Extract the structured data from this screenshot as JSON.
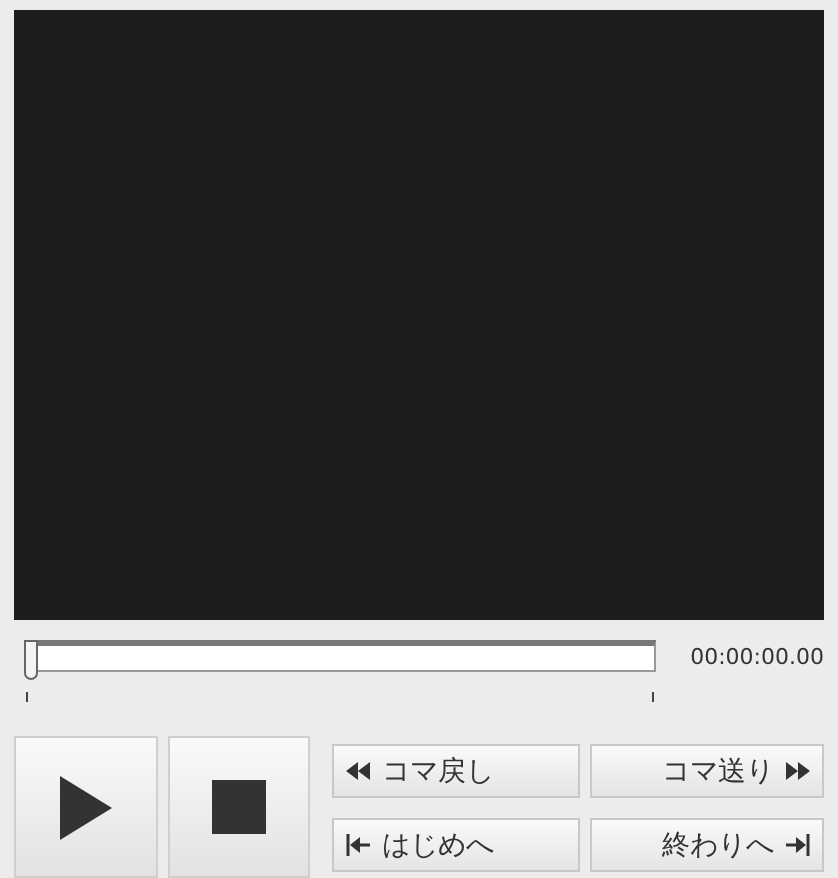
{
  "seek": {
    "level": 0
  },
  "time": "00:00:00.00",
  "buttons": [
    {
      "kind": "play"
    },
    {
      "kind": "stop"
    }
  ],
  "steps": [
    {
      "kind": "back",
      "label": "コマ戻し"
    },
    {
      "kind": "forward",
      "label": "コマ送り"
    },
    {
      "kind": "start",
      "label": "はじめへ"
    },
    {
      "kind": "end",
      "label": "終わりへ"
    }
  ]
}
